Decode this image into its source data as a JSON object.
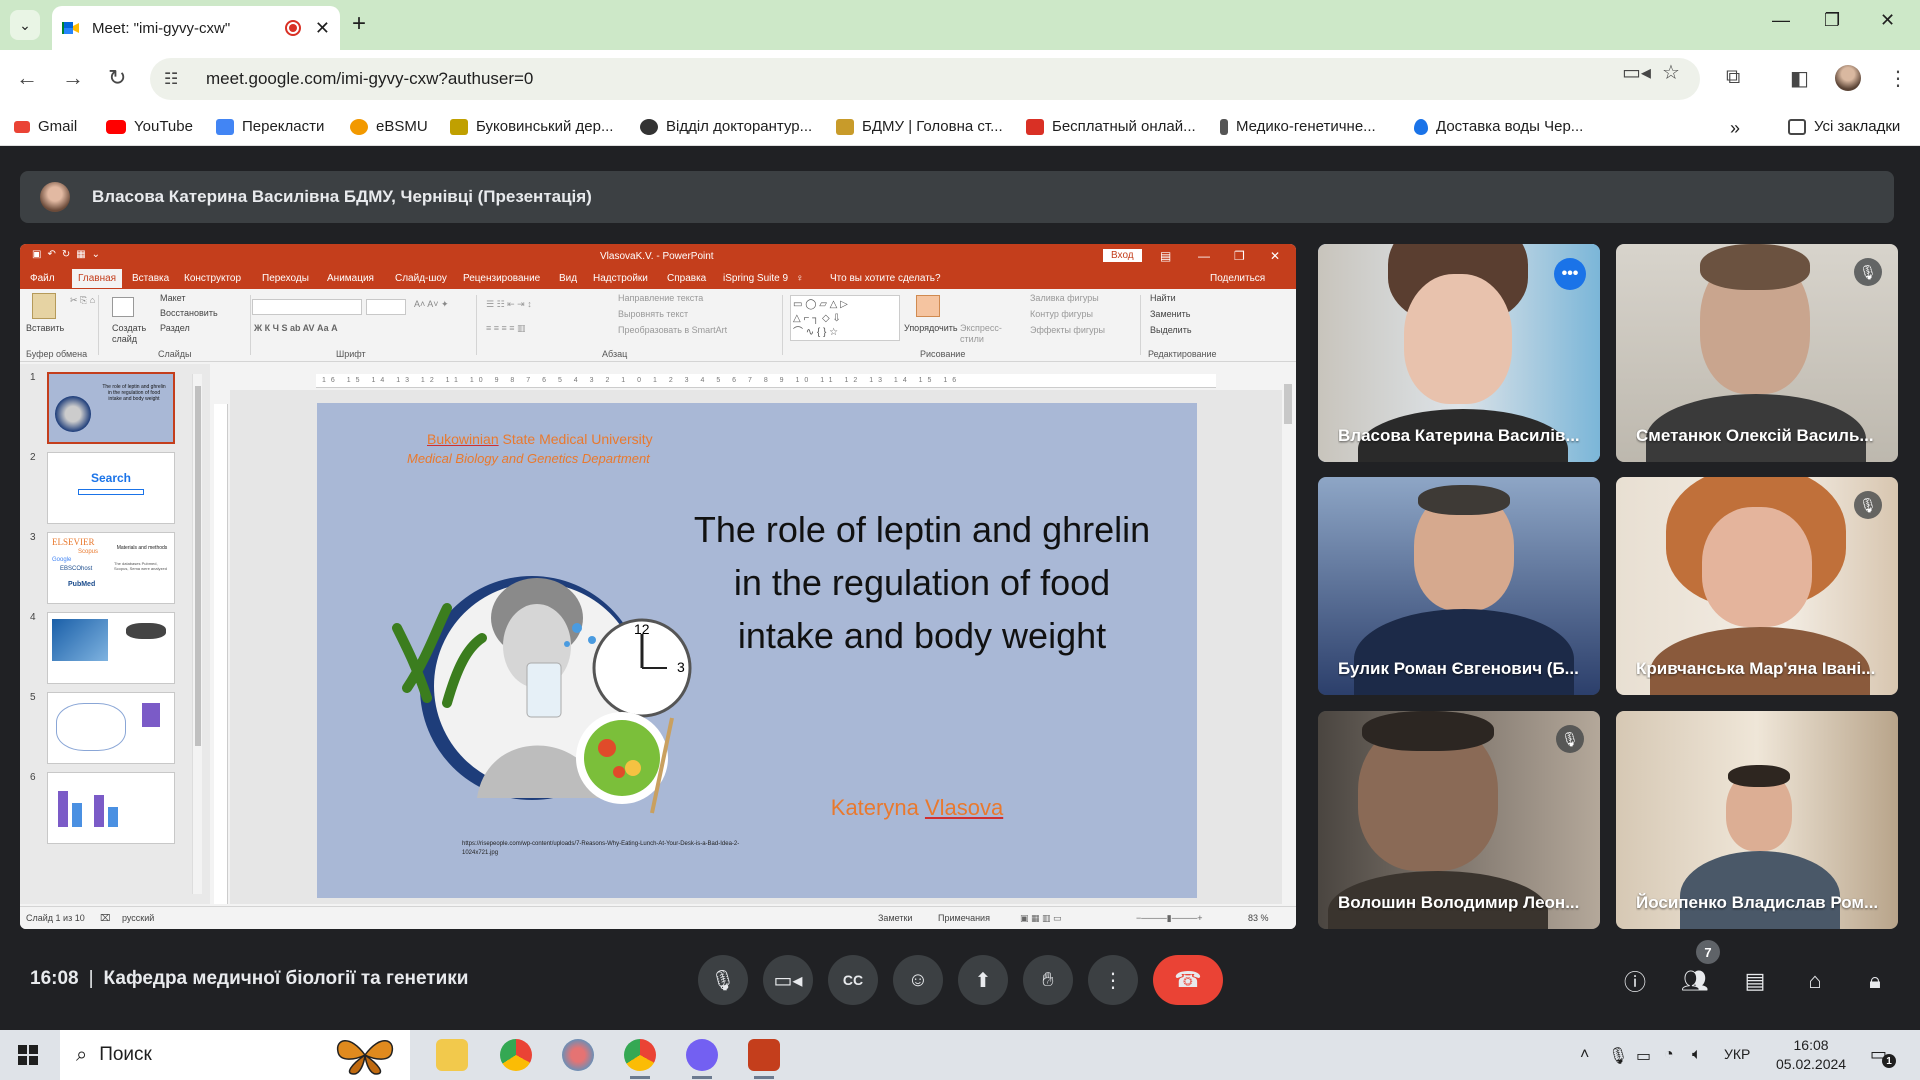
{
  "browser": {
    "tab_title": "Meet: \"imi-gyvy-cxw\"",
    "close_tab": "✕",
    "new_tab": "+",
    "url": "meet.google.com/imi-gyvy-cxw?authuser=0",
    "bookmarks": [
      {
        "label": "Gmail",
        "color": "#ea4335"
      },
      {
        "label": "YouTube",
        "color": "#ff0000"
      },
      {
        "label": "Перекласти",
        "color": "#4285f4"
      },
      {
        "label": "eBSMU",
        "color": "#f29900"
      },
      {
        "label": "Буковинський дер...",
        "color": "#c0a000"
      },
      {
        "label": "Відділ докторантур...",
        "color": "#333333"
      },
      {
        "label": "БДМУ | Головна ст...",
        "color": "#c89b2a"
      },
      {
        "label": "Бесплатный онлай...",
        "color": "#d93025"
      },
      {
        "label": "Медико-генетичне...",
        "color": "#555555"
      },
      {
        "label": "Доставка воды Чер...",
        "color": "#1a73e8"
      }
    ],
    "all_bookmarks": "Усі закладки",
    "more_bookmarks": "»"
  },
  "presenter": {
    "label": "Власова Катерина Василівна БДМУ, Чернівці (Презентація)"
  },
  "powerpoint": {
    "title": "VlasovaK.V. - PowerPoint",
    "signin": "Вход",
    "menu": [
      "Файл",
      "Главная",
      "Вставка",
      "Конструктор",
      "Переходы",
      "Анимация",
      "Слайд-шоу",
      "Рецензирование",
      "Вид",
      "Надстройки",
      "Справка",
      "iSpring Suite 9"
    ],
    "tell_me": "Что вы хотите сделать?",
    "share": "Поделиться",
    "ribbon": {
      "paste": "Вставить",
      "new_slide": "Создать слайд",
      "layout": "Макет",
      "reset": "Восстановить",
      "section": "Раздел",
      "text_direction": "Направление текста",
      "align_text": "Выровнять текст",
      "smartart": "Преобразовать в SmartArt",
      "arrange": "Упорядочить",
      "quick_styles": "Экспресс-стили",
      "shape_fill": "Заливка фигуры",
      "shape_outline": "Контур фигуры",
      "shape_effects": "Эффекты фигуры",
      "find": "Найти",
      "replace": "Заменить",
      "select": "Выделить",
      "groups": [
        "Буфер обмена",
        "Слайды",
        "Шрифт",
        "Абзац",
        "Рисование",
        "Редактирование"
      ]
    },
    "thumb_numbers": [
      "1",
      "2",
      "3",
      "4",
      "5",
      "6"
    ],
    "thumb_texts": {
      "t1": "The role of leptin and ghrelin in the regulation of food intake and body weight",
      "t2": "Search",
      "t3a": "ELSEVIER",
      "t3b": "Scopus",
      "t3c": "Google",
      "t3d": "EBSCOhost",
      "t3e": "PubMed",
      "t3f": "Materials and methods",
      "t3g": "The databases Pubmed, Scopus, Sema were analyzed"
    },
    "slide": {
      "university_prefix": "Bukowinian",
      "university_rest": " State Medical University",
      "department": "Medical Biology and Genetics Department",
      "title": "The role of leptin and ghrelin in the regulation of food intake and body weight",
      "author_first": "Kateryna ",
      "author_last": "Vlasova",
      "citation": "https://risepeople.com/wp-content/uploads/7-Reasons-Why-Eating-Lunch-At-Your-Desk-is-a-Bad-Idea-2-1024x721.jpg"
    },
    "status": {
      "slide_count": "Слайд 1 из 10",
      "language": "русский",
      "notes": "Заметки",
      "comments": "Примечания",
      "zoom": "83 %"
    }
  },
  "participants": [
    {
      "name": "Власова Катерина Василів...",
      "muted": false,
      "active": true
    },
    {
      "name": "Сметанюк Олексій Василь...",
      "muted": true
    },
    {
      "name": "Булик Роман Євгенович (Б...",
      "muted": false
    },
    {
      "name": "Кривчанська Мар'яна Івані...",
      "muted": true
    },
    {
      "name": "Волошин Володимир Леон...",
      "muted": true
    },
    {
      "name": "Йосипенко Владислав Ром...",
      "muted": false
    }
  ],
  "meeting": {
    "time": "16:08",
    "separator": "|",
    "room_name": "Кафедра медичної біології та генетики",
    "participant_count": "7"
  },
  "taskbar": {
    "search_placeholder": "Поиск",
    "language": "УКР",
    "time": "16:08",
    "date": "05.02.2024",
    "notifications": "1"
  }
}
